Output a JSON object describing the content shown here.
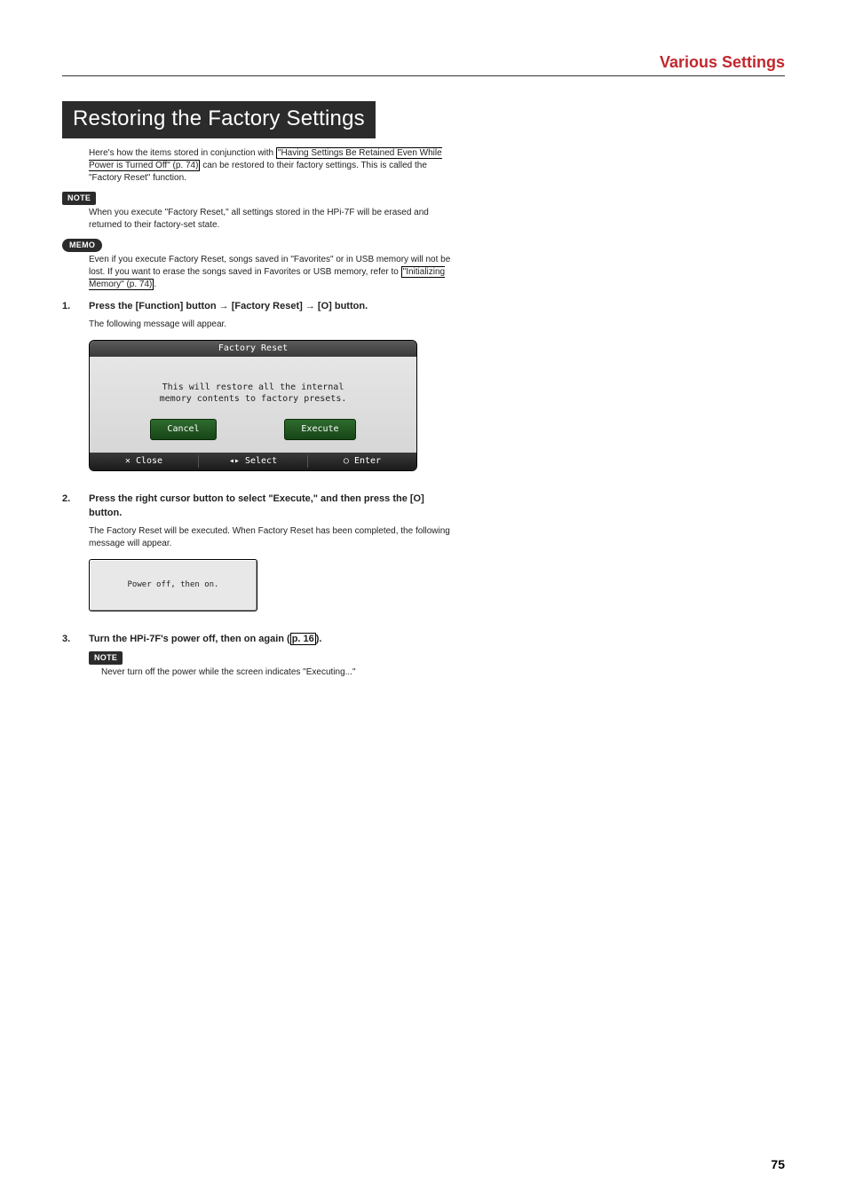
{
  "header": {
    "section_title": "Various Settings"
  },
  "banner": {
    "title": "Restoring the Factory Settings"
  },
  "intro": {
    "prefix": "Here's how the items stored in conjunction with ",
    "link": "\"Having Settings Be Retained Even While Power is Turned Off\" (p. 74)",
    "suffix": " can be restored to their factory settings. This is called the \"Factory Reset\" function."
  },
  "note1": {
    "label": "NOTE",
    "body": "When you execute \"Factory Reset,\" all settings stored in the HPi-7F will be erased and returned to their factory-set state."
  },
  "memo1": {
    "label": "MEMO",
    "body_prefix": "Even if you execute Factory Reset, songs saved in \"Favorites\" or in USB memory will not be lost. If you want to erase the songs saved in Favorites or USB memory, refer to ",
    "body_link": "\"Initializing Memory\" (p. 74)",
    "body_suffix": "."
  },
  "step1": {
    "num": "1.",
    "title_parts": {
      "p1": "Press the [Function] button ",
      "arrow1": "→",
      "p2": " [Factory Reset] ",
      "arrow2": "→",
      "p3": " [O] button."
    },
    "desc": "The following message will appear."
  },
  "scr1": {
    "title": "Factory Reset",
    "line1": "This will restore all the internal",
    "line2": "memory contents to factory presets.",
    "btn_cancel": "Cancel",
    "btn_execute": "Execute",
    "foot_close": "✕ Close",
    "foot_select": "◂▸ Select",
    "foot_enter": "○ Enter"
  },
  "step2": {
    "num": "2.",
    "title": "Press the right cursor button to select \"Execute,\" and then press the [O] button.",
    "desc": "The Factory Reset will be executed. When Factory Reset has been completed, the following message will appear."
  },
  "scr2": {
    "text": "Power off, then on."
  },
  "step3": {
    "num": "3.",
    "title_prefix": "Turn the HPi-7F's power off, then on again (",
    "title_link": "p. 16",
    "title_suffix": ")."
  },
  "note2": {
    "label": "NOTE",
    "body": "Never turn off the power while the screen indicates \"Executing...\""
  },
  "page_number": "75"
}
